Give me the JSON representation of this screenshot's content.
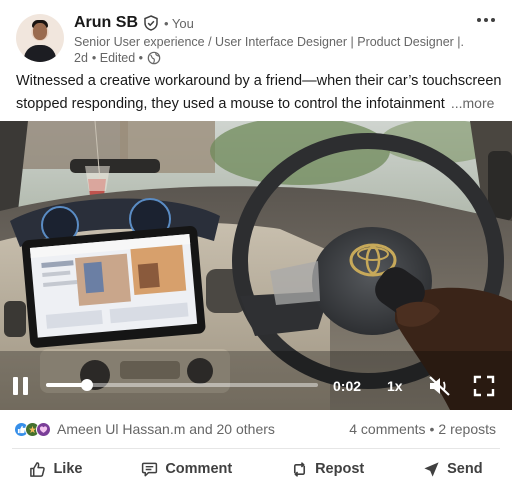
{
  "author": {
    "name": "Arun SB",
    "relation": "• You",
    "headline": "Senior User experience / User Interface Designer | Product Designer |...",
    "timestamp": "2d",
    "edited": "• Edited •"
  },
  "post": {
    "text_line1": "Witnessed a creative workaround by a friend—when their car’s touchscreen",
    "text_line2": "stopped responding, they used a mouse to control the infotainment",
    "see_more": "...more"
  },
  "video": {
    "current_time": "0:02",
    "speed": "1x",
    "progress_percent": 15,
    "muted": true
  },
  "social": {
    "reactions": [
      "like",
      "celebrate",
      "support"
    ],
    "reactors_text": "Ameen Ul Hassan.m and 20 others",
    "comments": "4 comments",
    "separator": "•",
    "reposts": "2 reposts"
  },
  "actions": {
    "like": "Like",
    "comment": "Comment",
    "repost": "Repost",
    "send": "Send"
  },
  "colors": {
    "like_blue": "#378fe9",
    "celebrate_green": "#44712e",
    "support_purple": "#7a3e98",
    "muted_text": "#666666"
  }
}
